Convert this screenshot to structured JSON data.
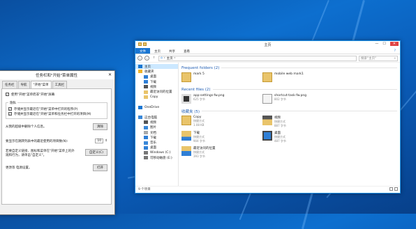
{
  "explorer": {
    "title": "主页",
    "window_buttons": [
      "—",
      "☐",
      "✕"
    ],
    "ribbon_tabs": [
      "文件",
      "主页",
      "共享",
      "查看"
    ],
    "help": "?",
    "address": {
      "home": "主页",
      "chevron": "›",
      "search_placeholder": "搜索\"主页\""
    },
    "nav": [
      {
        "label": "主页",
        "icon": "home-icon",
        "sel": true,
        "level": 1
      },
      {
        "label": "收藏夹",
        "icon": "star-icon",
        "level": 1
      },
      {
        "label": "桌面",
        "icon": "desktop-icon",
        "level": 2
      },
      {
        "label": "下载",
        "icon": "download-icon",
        "level": 2
      },
      {
        "label": "视频",
        "icon": "video-icon",
        "level": 2
      },
      {
        "label": "最近访问的位置",
        "icon": "recent-icon",
        "level": 2
      },
      {
        "label": "Copy",
        "icon": "folder-icon",
        "level": 2
      },
      {
        "label": "",
        "icon": "",
        "level": 0
      },
      {
        "label": "OneDrive",
        "icon": "cloud-icon",
        "level": 1
      },
      {
        "label": "",
        "icon": "",
        "level": 0
      },
      {
        "label": "这台电脑",
        "icon": "pc-icon",
        "level": 1
      },
      {
        "label": "视频",
        "icon": "video-icon",
        "level": 2
      },
      {
        "label": "图片",
        "icon": "picture-icon",
        "level": 2
      },
      {
        "label": "文档",
        "icon": "document-icon",
        "level": 2
      },
      {
        "label": "下载",
        "icon": "download-icon",
        "level": 2
      },
      {
        "label": "音乐",
        "icon": "music-icon",
        "level": 2
      },
      {
        "label": "桌面",
        "icon": "desktop-icon",
        "level": 2
      },
      {
        "label": "Windows (C:)",
        "icon": "drive-icon",
        "level": 2
      },
      {
        "label": "可移动磁盘 (E:)",
        "icon": "usb-icon",
        "level": 2
      }
    ],
    "groups": [
      {
        "header": "Frequent folders (2)",
        "items": [
          {
            "name": "mark 5",
            "sub": "",
            "thumb": "folder"
          },
          {
            "name": "mobile web mark1",
            "sub": "",
            "thumb": "folder"
          }
        ]
      },
      {
        "header": "Recent files (2)",
        "items": [
          {
            "name": "app-settings-fw.png",
            "sub": "625 字节",
            "thumb": "image-dark"
          },
          {
            "name": "shortcut-task-fw.png",
            "sub": "802 字节",
            "thumb": "image-light"
          }
        ]
      },
      {
        "header": "收藏夹 (5)",
        "items": [
          {
            "name": "Copy",
            "sub": "快捷方式\n1.08 KB",
            "thumb": "folder"
          },
          {
            "name": "视频",
            "sub": "快捷方式\n887 字节",
            "thumb": "video-folder"
          },
          {
            "name": "下载",
            "sub": "快捷方式\n904 字节",
            "thumb": "download-folder"
          },
          {
            "name": "桌面",
            "sub": "快捷方式\n487 字节",
            "thumb": "desktop"
          },
          {
            "name": "最近访问的位置",
            "sub": "快捷方式\n393 字节",
            "thumb": "recent"
          }
        ]
      }
    ],
    "status": "9 个项目"
  },
  "dialog": {
    "title": "任务栏和\"开始\"菜单属性",
    "close": "✕",
    "tabs": [
      "任务栏",
      "导航",
      "\"开始\"菜单",
      "工具栏"
    ],
    "active_tab": 2,
    "use_start_menu": "使用\"开始\"菜单而非\"开始\"屏幕",
    "privacy_label": "隐私",
    "privacy_items": [
      "存储并显示最近在\"开始\"菜单中打开的程序(P)",
      "存储并显示最近在\"开始\"菜单和任务栏中打开的项目(M)"
    ],
    "clear_text": "从我的超级中删除个人信息。",
    "clear_button": "清除",
    "recent_count_label": "要显示在跳转列表中的最近使用的项目数(N):",
    "recent_count": "10",
    "customize_text": "若要自定义链接、图标和菜单在\"开始\"菜单上的外观和行为，请单击\"自定义\"。",
    "customize_button": "自定义(C)",
    "more_text": "更改等 电源设置。",
    "open_button": "打开"
  },
  "colors": {
    "accent": "#1976d2",
    "folder": "#e9c46a"
  }
}
